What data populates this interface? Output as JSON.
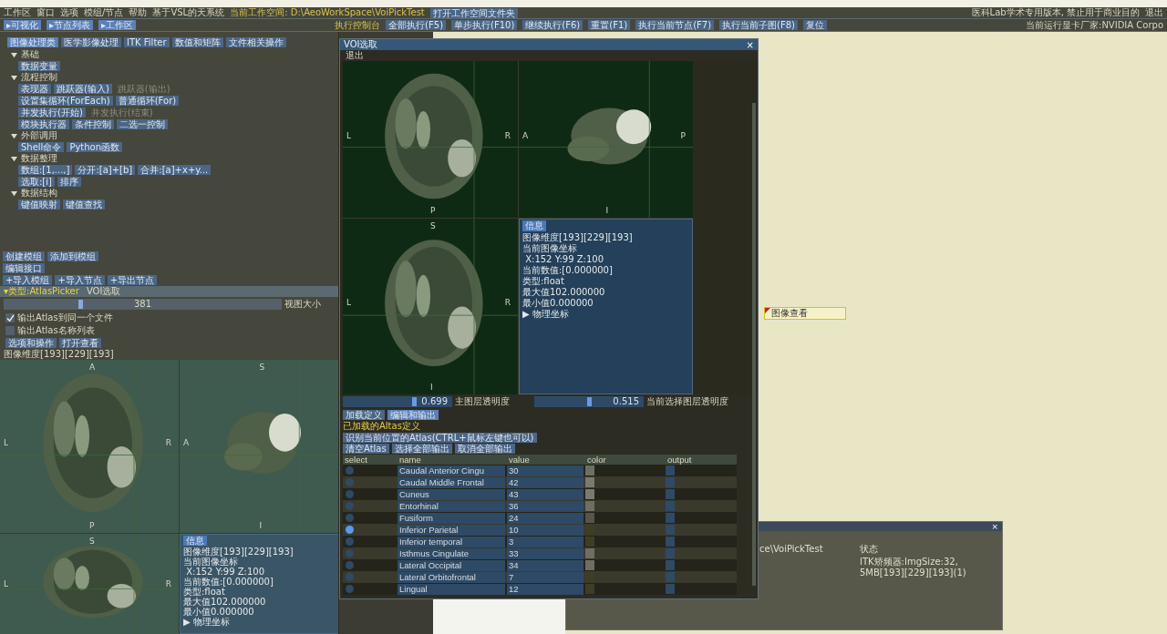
{
  "menu_bar": {
    "items": [
      "工作区",
      "窗口",
      "选项",
      "模组/节点",
      "帮助",
      "基于VSL的天系统"
    ],
    "workspace": "当前工作空间: D:\\AeoWorkSpace\\VoiPickTest",
    "open_button": "打开工作空间文件夹",
    "notice": "医科Lab学术专用版本, 禁止用于商业目的",
    "exit": "退出"
  },
  "toolbar": {
    "toggles": [
      {
        "label": "▸可视化",
        "on": true
      },
      {
        "label": "▸节点列表",
        "on": true
      },
      {
        "label": "▸工作区",
        "on": true
      }
    ],
    "console": "执行控制台",
    "buttons": [
      "全部执行(F5)",
      "单步执行(F10)",
      "继续执行(F6)",
      "重置(F1)",
      "执行当前节点(F7)",
      "执行当前子图(F8)",
      "复位"
    ],
    "gpu": "当前运行显卡厂家:NVIDIA Corpo"
  },
  "left_panel": {
    "tabs": [
      {
        "label": "图像处理类",
        "selected": true
      },
      {
        "label": "医学影像处理",
        "selected": false
      },
      {
        "label": "ITK Filter",
        "selected": false
      },
      {
        "label": "数值和矩阵",
        "selected": false
      },
      {
        "label": "文件相关操作",
        "selected": false
      }
    ],
    "tree": [
      {
        "label": "基础",
        "expanded": true,
        "rows": [
          [
            {
              "label": "数据变量",
              "disabled": false
            }
          ]
        ]
      },
      {
        "label": "流程控制",
        "expanded": true,
        "rows": [
          [
            {
              "label": "表现器",
              "disabled": false
            },
            {
              "label": "跳跃器(输入)",
              "disabled": false
            },
            {
              "label": "跳跃器(输出)",
              "disabled": true
            }
          ],
          [
            {
              "label": "设置集循环(ForEach)",
              "disabled": false
            },
            {
              "label": "普通循环(For)",
              "disabled": false
            }
          ],
          [
            {
              "label": "并发执行(开始)",
              "disabled": false
            },
            {
              "label": "并发执行(结束)",
              "disabled": true
            }
          ],
          [
            {
              "label": "模块执行器",
              "disabled": false
            },
            {
              "label": "条件控制",
              "disabled": false
            },
            {
              "label": "二选一控制",
              "disabled": false
            }
          ]
        ]
      },
      {
        "label": "外部调用",
        "expanded": true,
        "rows": [
          [
            {
              "label": "Shell命令",
              "disabled": false
            },
            {
              "label": "Python函数",
              "disabled": false
            }
          ]
        ]
      },
      {
        "label": "数据整理",
        "expanded": true,
        "rows": [
          [
            {
              "label": "数组:[1,...,]",
              "disabled": false
            },
            {
              "label": "分开:[a]+[b]",
              "disabled": false
            },
            {
              "label": "合并:[a]+x+y...",
              "disabled": false
            }
          ],
          [
            {
              "label": "选取:[i]",
              "disabled": false
            },
            {
              "label": "排序",
              "disabled": false
            }
          ]
        ]
      },
      {
        "label": "数据结构",
        "expanded": true,
        "rows": [
          [
            {
              "label": "键值映射",
              "disabled": false
            },
            {
              "label": "键值查找",
              "disabled": false
            }
          ]
        ]
      }
    ],
    "module_buttons": [
      [
        "创建模组",
        "添加到模组"
      ],
      [
        "编辑接口"
      ],
      [
        "+导入模组",
        "+导入节点",
        "+导出节点"
      ]
    ],
    "node": {
      "type_label": "▾类型:AtlasPicker",
      "name": "VOI选取",
      "slider": {
        "value": "381",
        "level": 0.27,
        "label": "视图大小"
      },
      "options": [
        {
          "label": "输出Atlas到同一个文件",
          "checked": true
        },
        {
          "label": "输出Atlas名称列表",
          "checked": false
        }
      ],
      "buttons": [
        "选项和操作",
        "打开查看"
      ],
      "dimensions": "图像维度[193][229][193]",
      "viewer": {
        "views": [
          {
            "top": "A",
            "left": "L",
            "right": "R",
            "bottom": "P"
          },
          {
            "top": "S",
            "left": "A",
            "bottom": "I"
          },
          {
            "top": "S",
            "left": "L",
            "right": "R"
          }
        ],
        "info": {
          "title": "信息",
          "lines": [
            "图像维度[193][229][193]",
            "当前图像坐标",
            " X:152 Y:99 Z:100",
            "当前数值:[0.000000]",
            "类型:float",
            "最大值102.000000",
            "最小值0.000000"
          ],
          "expander": "▶ 物理坐标"
        }
      }
    }
  },
  "dialog": {
    "title": "VOI选取",
    "close": "×",
    "menu": "退出",
    "viewer": {
      "views": [
        {
          "left": "L",
          "right": "R",
          "bottom": "P"
        },
        {
          "left": "A",
          "right": "P",
          "bottom": "I"
        },
        {
          "top": "S",
          "left": "L",
          "right": "R",
          "bottom": "I"
        }
      ],
      "info": {
        "title": "信息",
        "lines": [
          "图像维度[193][229][193]",
          "当前图像坐标",
          " X:152 Y:99 Z:100",
          "当前数值:[0.000000]",
          "类型:float",
          "最大值102.000000",
          "最小值0.000000"
        ],
        "expander": "▶ 物理坐标"
      }
    },
    "opacity": [
      {
        "value": "0.699",
        "level": 0.66,
        "label": "主图层透明度"
      },
      {
        "value": "0.515",
        "level": 0.5,
        "label": "当前选择图层透明度"
      }
    ],
    "tabs": [
      {
        "label": "加载定义",
        "selected": false
      },
      {
        "label": "编辑和输出",
        "selected": true
      }
    ],
    "loaded_label": "已加载的Altas定义",
    "identify_button": "识别当前位置的Atlas(CTRL+鼠标左键也可以)",
    "actions": [
      "清空Atlas",
      "选择全部输出",
      "取消全部输出"
    ],
    "table": {
      "columns": [
        "select",
        "name",
        "value",
        "color",
        "output"
      ],
      "rows": [
        {
          "selected": false,
          "name": "Caudal Anterior Cingu",
          "value": "30",
          "color": "#6e6e64",
          "output": false
        },
        {
          "selected": false,
          "name": "Caudal Middle Frontal",
          "value": "42",
          "color": "#7a7a70",
          "output": false
        },
        {
          "selected": false,
          "name": "Cuneus",
          "value": "43",
          "color": "#7a7a70",
          "output": false
        },
        {
          "selected": false,
          "name": "Entorhinal",
          "value": "36",
          "color": "#6e6e64",
          "output": false
        },
        {
          "selected": false,
          "name": "Fusiform",
          "value": "24",
          "color": "#55554a",
          "output": false
        },
        {
          "selected": true,
          "name": "Inferior Parietal",
          "value": "10",
          "color": "#3e3e26",
          "output": false
        },
        {
          "selected": false,
          "name": "Inferior temporal",
          "value": "3",
          "color": "#3e3e26",
          "output": false
        },
        {
          "selected": false,
          "name": "Isthmus Cingulate",
          "value": "33",
          "color": "#6e6e64",
          "output": false
        },
        {
          "selected": false,
          "name": "Lateral Occipital",
          "value": "34",
          "color": "#6e6e64",
          "output": false
        },
        {
          "selected": false,
          "name": "Lateral Orbitofrontal",
          "value": "7",
          "color": "#3e3e26",
          "output": false
        },
        {
          "selected": false,
          "name": "Lingual",
          "value": "12",
          "color": "#3e3e26",
          "output": false
        }
      ]
    }
  },
  "image_field": {
    "value": "图像查看"
  },
  "status_window": {
    "close": "×",
    "column": "状态",
    "path": "ce\\VoiPickTest",
    "lines": [
      "ITK矫频器:ImgSize:32,",
      "5MB[193][229][193](1)"
    ]
  }
}
